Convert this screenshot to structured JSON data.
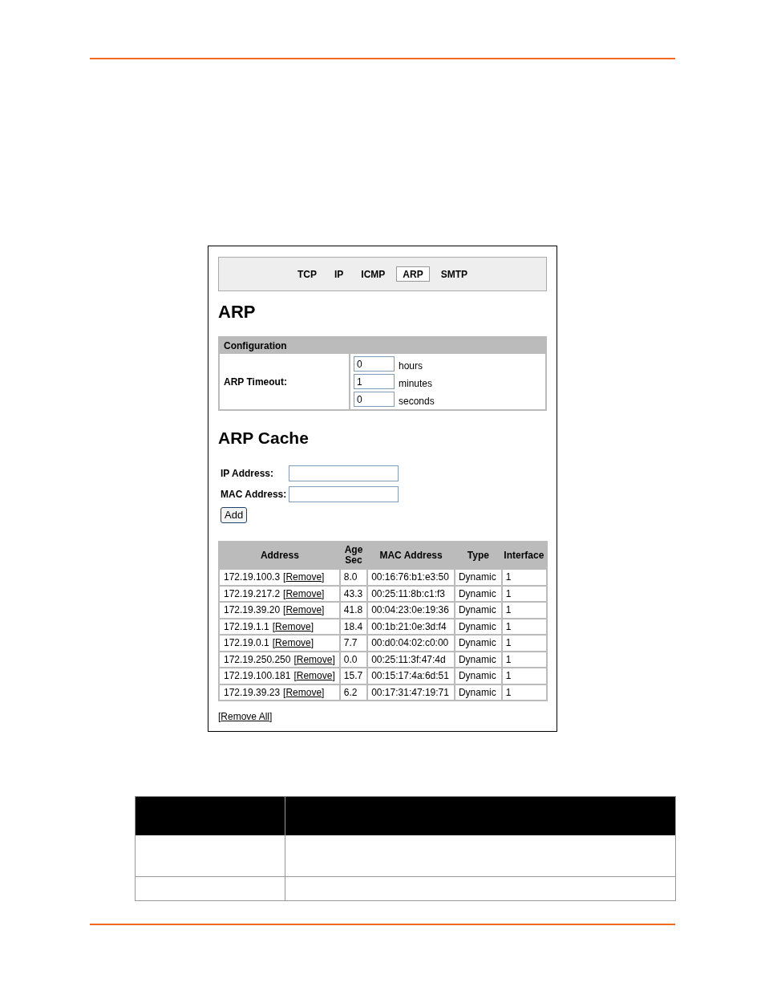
{
  "tabs": [
    {
      "label": "TCP",
      "selected": false
    },
    {
      "label": "IP",
      "selected": false
    },
    {
      "label": "ICMP",
      "selected": false
    },
    {
      "label": "ARP",
      "selected": true
    },
    {
      "label": "SMTP",
      "selected": false
    }
  ],
  "heading": "ARP",
  "configuration": {
    "title": "Configuration",
    "label": "ARP Timeout:",
    "fields": [
      {
        "value": "0",
        "unit": "hours"
      },
      {
        "value": "1",
        "unit": "minutes"
      },
      {
        "value": "0",
        "unit": "seconds"
      }
    ]
  },
  "cache": {
    "heading": "ARP Cache",
    "form": [
      {
        "label": "IP Address:"
      },
      {
        "label": "MAC Address:"
      }
    ],
    "add_button": "Add"
  },
  "table": {
    "columns": [
      "Address",
      "Age Sec",
      "MAC Address",
      "Type",
      "Interface"
    ],
    "rows": [
      {
        "address": "172.19.100.3",
        "remove_link": [
          "[",
          "Remove",
          "]"
        ],
        "age": "8.0",
        "mac": "00:16:76:b1:e3:50",
        "type": "Dynamic",
        "interface": "1"
      },
      {
        "address": "172.19.217.2",
        "remove_link": [
          "[",
          "Remove",
          "]"
        ],
        "age": "43.3",
        "mac": "00:25:11:8b:c1:f3",
        "type": "Dynamic",
        "interface": "1"
      },
      {
        "address": "172.19.39.20",
        "remove_link": [
          "[",
          "Remove",
          "]"
        ],
        "age": "41.8",
        "mac": "00:04:23:0e:19:36",
        "type": "Dynamic",
        "interface": "1"
      },
      {
        "address": "172.19.1.1",
        "remove_link": [
          "[",
          "Remove",
          "]"
        ],
        "age": "18.4",
        "mac": "00:1b:21:0e:3d:f4",
        "type": "Dynamic",
        "interface": "1"
      },
      {
        "address": "172.19.0.1",
        "remove_link": [
          "[",
          "Remove",
          "]"
        ],
        "age": "7.7",
        "mac": "00:d0:04:02:c0:00",
        "type": "Dynamic",
        "interface": "1"
      },
      {
        "address": "172.19.250.250",
        "remove_link": [
          "[",
          "Remove",
          "]"
        ],
        "age": "0.0",
        "mac": "00:25:11:3f:47:4d",
        "type": "Dynamic",
        "interface": "1"
      },
      {
        "address": "172.19.100.181",
        "remove_link": [
          "[",
          "Remove",
          "]"
        ],
        "age": "15.7",
        "mac": "00:15:17:4a:6d:51",
        "type": "Dynamic",
        "interface": "1"
      },
      {
        "address": "172.19.39.23",
        "remove_link": [
          "[",
          "Remove",
          "]"
        ],
        "age": "6.2",
        "mac": "00:17:31:47:19:71",
        "type": "Dynamic",
        "interface": "1"
      }
    ]
  },
  "remove_all_link": [
    "[",
    "Remove All",
    "]"
  ]
}
